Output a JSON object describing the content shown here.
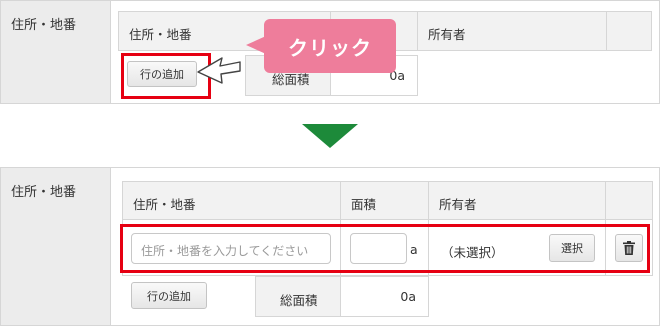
{
  "top": {
    "section_label": "住所・地番",
    "header": {
      "address": "住所・地番",
      "owner": "所有者"
    },
    "add_row_button": "行の追加",
    "total_area_label": "総面積",
    "total_area_value": "0a",
    "callout_text": "クリック"
  },
  "bottom": {
    "section_label": "住所・地番",
    "header": {
      "address": "住所・地番",
      "area": "面積",
      "owner": "所有者"
    },
    "address_placeholder": "住所・地番を入力してください",
    "area_unit": "a",
    "owner_value": "（未選択）",
    "select_button": "選択",
    "add_row_button": "行の追加",
    "total_area_label": "総面積",
    "total_area_value": "0a"
  },
  "colors": {
    "highlight_red": "#e60012",
    "callout_pink": "#ee7d9b",
    "arrow_green": "#1d8a3a"
  },
  "icons": {
    "delete": "trash-icon",
    "pointer": "cursor-arrow-icon"
  }
}
